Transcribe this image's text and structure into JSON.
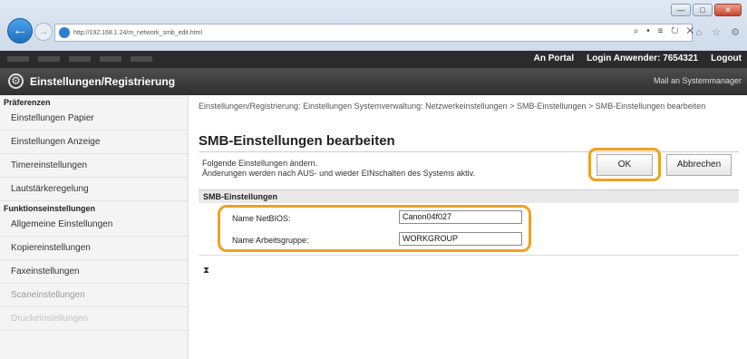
{
  "browser": {
    "url": "http://192.168.1.24/m_network_smb_edit.html",
    "addr_tools": "⌕ • ≡ ↻ ✕",
    "fav_icons": "⌂ ☆ ⚙"
  },
  "topbar": {
    "remote_ui_label": "An Portal",
    "login_label": "Login Anwender:",
    "login_user": "7654321",
    "logout": "Logout"
  },
  "header": {
    "title": "Einstellungen/Registrierung",
    "mail": "Mail an Systemmanager"
  },
  "sidebar": {
    "section1": "Präferenzen",
    "items1": [
      "Einstellungen Papier",
      "Einstellungen Anzeige",
      "Timereinstellungen",
      "Lautstärkeregelung"
    ],
    "section2": "Funktionseinstellungen",
    "items2": [
      "Allgemeine Einstellungen",
      "Kopiereinstellungen",
      "Faxeinstellungen",
      "Scaneinstellungen",
      "Druckeinstellungen"
    ]
  },
  "main": {
    "breadcrumb": "Einstellungen/Registrierung: Einstellungen Systemverwaltung: Netzwerkeinstellungen > SMB-Einstellungen > SMB-Einstellungen bearbeiten",
    "page_title": "SMB-Einstellungen bearbeiten",
    "desc1": "Folgende Einstellungen ändern.",
    "desc2": "Änderungen werden nach AUS- und wieder EINschalten des Systems aktiv.",
    "ok": "OK",
    "cancel": "Abbrechen",
    "section": "SMB-Einstellungen",
    "netbios_label": "Name NetBIOS:",
    "netbios_value": "Canon04f027",
    "workgroup_label": "Name Arbeitsgruppe:",
    "workgroup_value": "WORKGROUP",
    "to_top": "⧗"
  },
  "colors": {
    "highlight": "#f0a020",
    "accent": "#1f6fc0"
  }
}
